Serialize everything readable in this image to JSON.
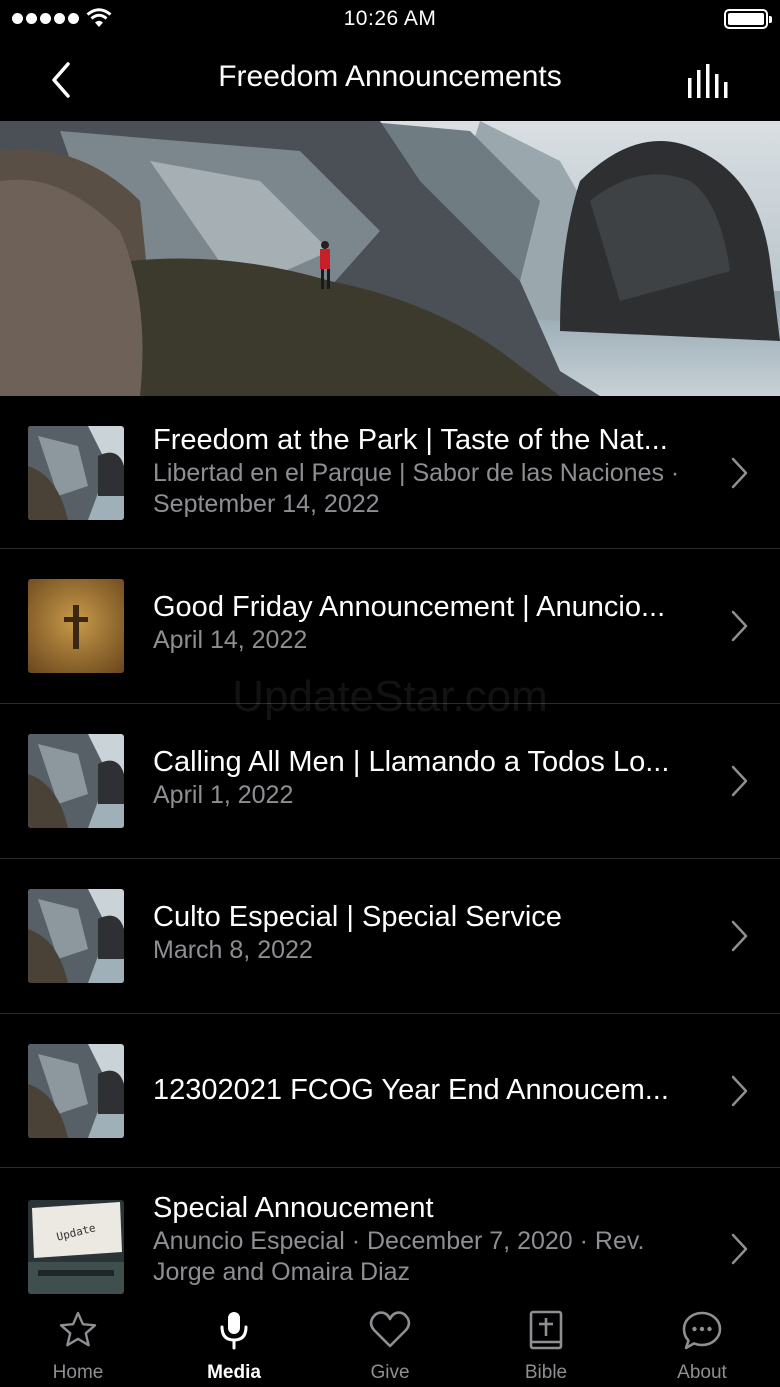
{
  "status_bar": {
    "time": "10:26 AM"
  },
  "nav": {
    "title": "Freedom Announcements"
  },
  "items": [
    {
      "title": "Freedom at the Park | Taste of the Nat...",
      "subtitle": "Libertad en el Parque | Sabor de las Naciones · September 14, 2022",
      "thumb": "cliff"
    },
    {
      "title": "Good Friday Announcement | Anuncio...",
      "subtitle": "April 14, 2022",
      "thumb": "cross"
    },
    {
      "title": "Calling All Men | Llamando a Todos Lo...",
      "subtitle": "April 1, 2022",
      "thumb": "cliff"
    },
    {
      "title": "Culto Especial | Special Service",
      "subtitle": "March 8, 2022",
      "thumb": "cliff"
    },
    {
      "title": "12302021 FCOG Year End Annoucem...",
      "subtitle": "",
      "thumb": "cliff"
    },
    {
      "title": "Special Annoucement",
      "subtitle": "Anuncio Especial · December 7, 2020 · Rev. Jorge and Omaira Diaz",
      "thumb": "typewriter",
      "thumb_text": "Update"
    }
  ],
  "tabs": [
    {
      "label": "Home",
      "icon": "star-icon",
      "active": false
    },
    {
      "label": "Media",
      "icon": "microphone-icon",
      "active": true
    },
    {
      "label": "Give",
      "icon": "heart-icon",
      "active": false
    },
    {
      "label": "Bible",
      "icon": "bible-icon",
      "active": false
    },
    {
      "label": "About",
      "icon": "chat-bubble-icon",
      "active": false
    }
  ],
  "watermark": "UpdateStar.com",
  "colors": {
    "background": "#000000",
    "secondary_text": "#8e8e93",
    "separator": "#2a2a2a"
  }
}
